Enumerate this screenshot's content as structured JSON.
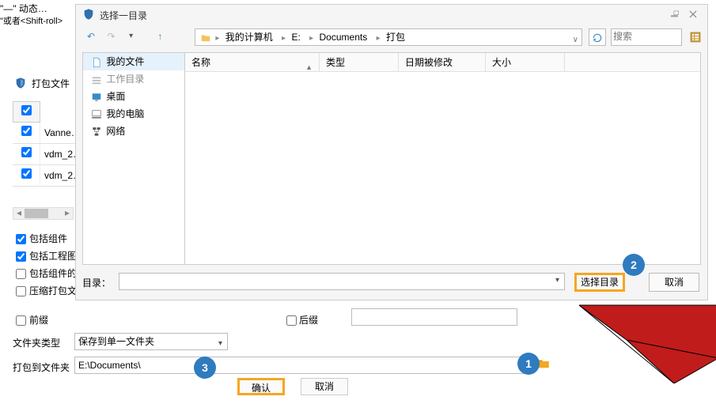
{
  "bg": {
    "top_hint_prev": "\"—\" 动态…",
    "top_hint_roll": "\"或者<Shift-roll>",
    "panel_title": "打包文件",
    "rows": [
      "Vanne…",
      "vdm_2…",
      "vdm_2…"
    ],
    "scroll_left": "◂",
    "scroll_right": "▸",
    "chk_group": "包括组件",
    "chk_proj": "包括工程图",
    "chk_group_items": "包括组件的…",
    "chk_compress": "压缩打包文…",
    "chk_prefix": "前缀",
    "chk_suffix": "后缀",
    "folder_type_label": "文件夹类型",
    "folder_type_value": "保存到单一文件夹",
    "pack_to_label": "打包到文件夹",
    "pack_to_value": "E:\\Documents\\",
    "ok": "确认",
    "cancel": "取消"
  },
  "dlg": {
    "title": "选择一目录",
    "back": "↶",
    "fwd": "↷",
    "recent": "▾",
    "up": "↑",
    "crumbs": [
      "我的计算机",
      "E:",
      "Documents",
      "打包"
    ],
    "crumb_sep": "▸",
    "refresh": "↻",
    "search_ph": "搜索",
    "tree": {
      "myfiles": "我的文件",
      "workdir": "工作目录",
      "desktop": "桌面",
      "mypc": "我的电脑",
      "network": "网络"
    },
    "cols": {
      "name": "名称",
      "type": "类型",
      "modified": "日期被修改",
      "size": "大小"
    },
    "dir_label": "目录：",
    "select_dir": "选择目录",
    "cancel": "取消"
  },
  "badges": {
    "b1": "1",
    "b2": "2",
    "b3": "3"
  }
}
